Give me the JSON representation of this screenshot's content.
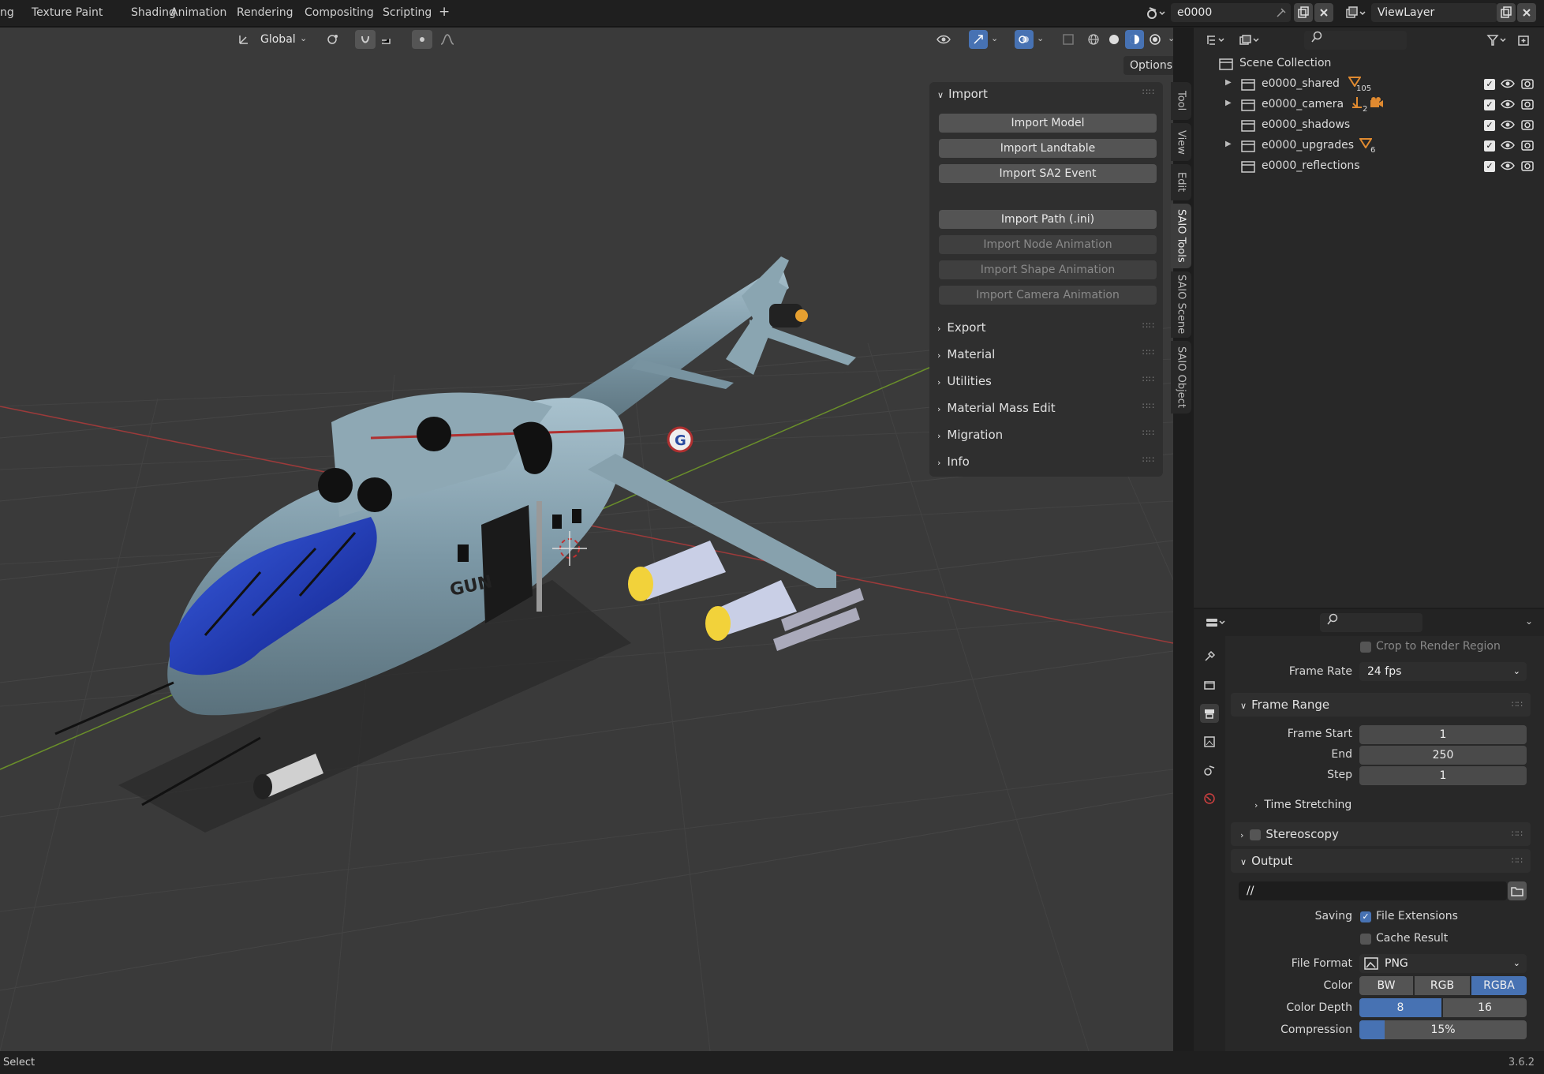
{
  "topbar": {
    "tabs": [
      "ng",
      "Texture Paint",
      "Shading",
      "Animation",
      "Rendering",
      "Compositing",
      "Scripting"
    ],
    "add_tab": "+",
    "scene_name": "e0000",
    "view_layer": "ViewLayer"
  },
  "viewport_header": {
    "orientation": "Global",
    "options_label": "Options"
  },
  "npanel": {
    "import_title": "Import",
    "buttons": [
      "Import Model",
      "Import Landtable",
      "Import SA2 Event",
      "Import Path (.ini)",
      "Import Node Animation",
      "Import Shape Animation",
      "Import Camera Animation"
    ],
    "sections": [
      "Export",
      "Material",
      "Utilities",
      "Material Mass Edit",
      "Migration",
      "Info"
    ],
    "tabs": [
      "Tool",
      "View",
      "Edit",
      "SAIO Tools",
      "SAIO Scene",
      "SAIO Object"
    ]
  },
  "model": {
    "fuselage_text": "GUN",
    "emblem": "G"
  },
  "outliner": {
    "root": "Scene Collection",
    "collections": [
      {
        "name": "e0000_shared",
        "badge": "105"
      },
      {
        "name": "e0000_camera",
        "badge": "2"
      },
      {
        "name": "e0000_shadows",
        "badge": ""
      },
      {
        "name": "e0000_upgrades",
        "badge": "6"
      },
      {
        "name": "e0000_reflections",
        "badge": ""
      }
    ]
  },
  "properties": {
    "crop_label": "Crop to Render Region",
    "frame_rate_label": "Frame Rate",
    "frame_rate_value": "24 fps",
    "frame_range_title": "Frame Range",
    "frame_start_label": "Frame Start",
    "frame_start": "1",
    "end_label": "End",
    "end": "250",
    "step_label": "Step",
    "step": "1",
    "time_stretching": "Time Stretching",
    "stereoscopy": "Stereoscopy",
    "output_title": "Output",
    "output_path": "//",
    "saving_label": "Saving",
    "file_extensions": "File Extensions",
    "cache_result": "Cache Result",
    "file_format_label": "File Format",
    "file_format": "PNG",
    "color_label": "Color",
    "color_options": [
      "BW",
      "RGB",
      "RGBA"
    ],
    "color_depth_label": "Color Depth",
    "color_depth_options": [
      "8",
      "16"
    ],
    "compression_label": "Compression",
    "compression": "15%",
    "compression_fraction": 0.15
  },
  "statusbar": {
    "left": "Select",
    "version": "3.6.2"
  },
  "colors": {
    "accent": "#4772b3",
    "viewport_bg": "#3a3a3a",
    "panel_bg": "#2f2f2f"
  }
}
